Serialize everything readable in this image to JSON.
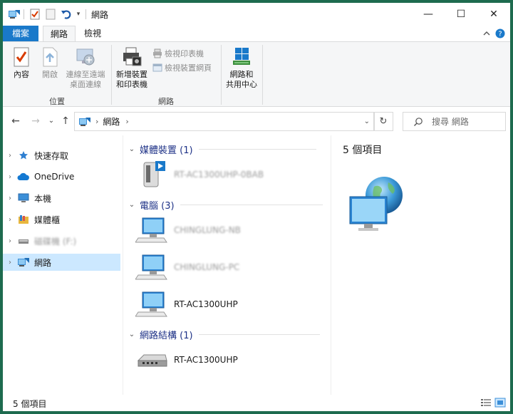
{
  "window": {
    "title": "網路",
    "controls": {
      "minimize": "—",
      "maximize": "☐",
      "close": "✕"
    }
  },
  "ribbon_tabs": {
    "file": "檔案",
    "network": "網路",
    "view": "檢視",
    "collapse_icon": "chevron-up-icon",
    "help_icon": "help-icon"
  },
  "ribbon": {
    "location_group": {
      "label": "位置",
      "properties": "內容",
      "open": "開啟",
      "remote_desktop_line1": "連線至遠端",
      "remote_desktop_line2": "桌面連線"
    },
    "network_group": {
      "label": "網路",
      "add_devices_line1": "新增裝置",
      "add_devices_line2": "和印表機",
      "view_printers": "檢視印表機",
      "view_device_webpage": "檢視裝置網頁"
    },
    "sharing_group": {
      "center_line1": "網路和",
      "center_line2": "共用中心"
    }
  },
  "address_bar": {
    "breadcrumb_root": "網路",
    "search_placeholder": "搜尋 網路"
  },
  "sidebar": {
    "items": [
      {
        "label": "快速存取",
        "icon": "star-icon"
      },
      {
        "label": "OneDrive",
        "icon": "cloud-icon"
      },
      {
        "label": "本機",
        "icon": "computer-icon"
      },
      {
        "label": "媒體櫃",
        "icon": "library-icon"
      },
      {
        "label": "磁碟機 (F:)",
        "icon": "drive-icon"
      },
      {
        "label": "網路",
        "icon": "network-icon"
      }
    ]
  },
  "content": {
    "groups": [
      {
        "title": "媒體裝置 (1)",
        "items": [
          {
            "name": "RT-AC1300UHP-0BAB",
            "icon": "media-device-icon"
          }
        ]
      },
      {
        "title": "電腦 (3)",
        "items": [
          {
            "name": "CHINGLUNG-NB",
            "icon": "computer-icon"
          },
          {
            "name": "CHINGLUNG-PC",
            "icon": "computer-icon"
          },
          {
            "name": "RT-AC1300UHP",
            "icon": "computer-icon"
          }
        ]
      },
      {
        "title": "網路結構 (1)",
        "items": [
          {
            "name": "RT-AC1300UHP",
            "icon": "router-icon"
          }
        ]
      }
    ]
  },
  "details": {
    "count": "5 個項目",
    "icon": "network-globe-icon"
  },
  "status_bar": {
    "count": "5 個項目"
  },
  "colors": {
    "accent": "#1979ca",
    "selection": "#cce8ff",
    "group_heading": "#1e3287",
    "window_border": "#1e6b4f"
  }
}
